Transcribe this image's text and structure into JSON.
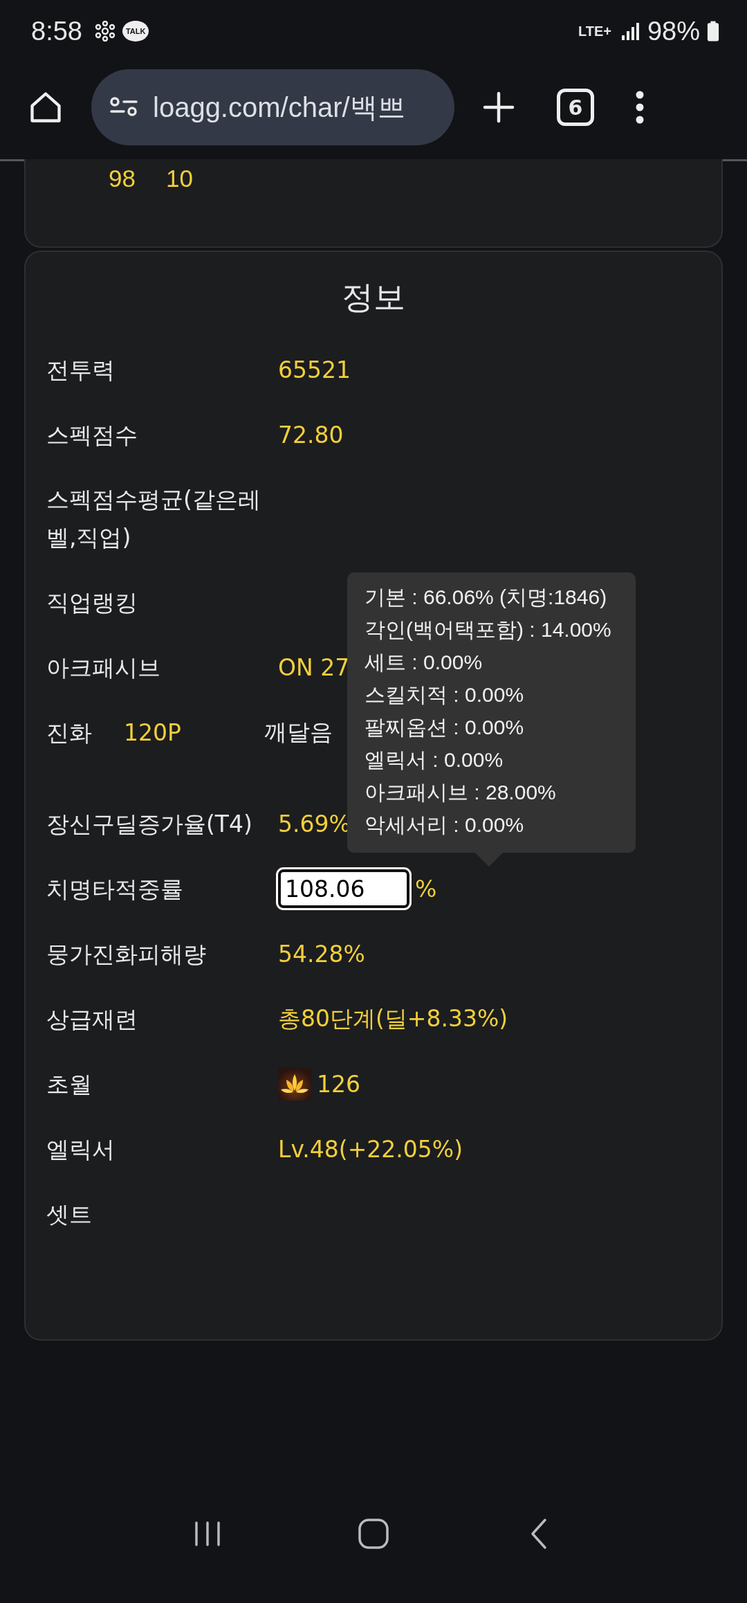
{
  "status_bar": {
    "time": "8:58",
    "talk_badge": "TALK",
    "network": "LTE+",
    "battery": "98%"
  },
  "browser": {
    "url": "loagg.com/char/백쁘",
    "tab_count": "6"
  },
  "previous_card": {
    "values": [
      "98",
      "10"
    ]
  },
  "info": {
    "title": "정보",
    "rows": [
      {
        "kind": "text",
        "label": "전투력",
        "value": "65521"
      },
      {
        "kind": "text",
        "label": "스펙점수",
        "value": "72.80"
      },
      {
        "kind": "text",
        "label": "스펙점수평균(같은레벨,직업)"
      },
      {
        "kind": "text",
        "label": "직업랭킹"
      },
      {
        "kind": "text",
        "label": "아크패시브",
        "value": "ON 27"
      },
      {
        "kind": "pair",
        "label": "진화",
        "value": "120P",
        "label_2": "깨달음"
      },
      {
        "kind": "text",
        "label": "장신구딜증가율(T4)",
        "value": "5.69%"
      },
      {
        "kind": "input",
        "label": "치명타적중률",
        "value": "108.06",
        "unit": "%"
      },
      {
        "kind": "text",
        "label": "뭉가진화피해량",
        "value": "54.28%"
      },
      {
        "kind": "text",
        "label": "상급재련",
        "value": "총80단계(딜+8.33%)"
      },
      {
        "kind": "icon",
        "label": "초월",
        "value": "126"
      },
      {
        "kind": "text",
        "label": "엘릭서",
        "value": "Lv.48(+22.05%)"
      },
      {
        "kind": "text",
        "label": "셋트"
      }
    ],
    "tooltip": {
      "lines": [
        "기본 : 66.06% (치명:1846)",
        "각인(백어택포함) : 14.00%",
        "세트 : 0.00%",
        "스킬치적 : 0.00%",
        "팔찌옵션 : 0.00%",
        "엘릭서 : 0.00%",
        "아크패시브 : 28.00%",
        "악세서리 : 0.00%"
      ]
    }
  }
}
